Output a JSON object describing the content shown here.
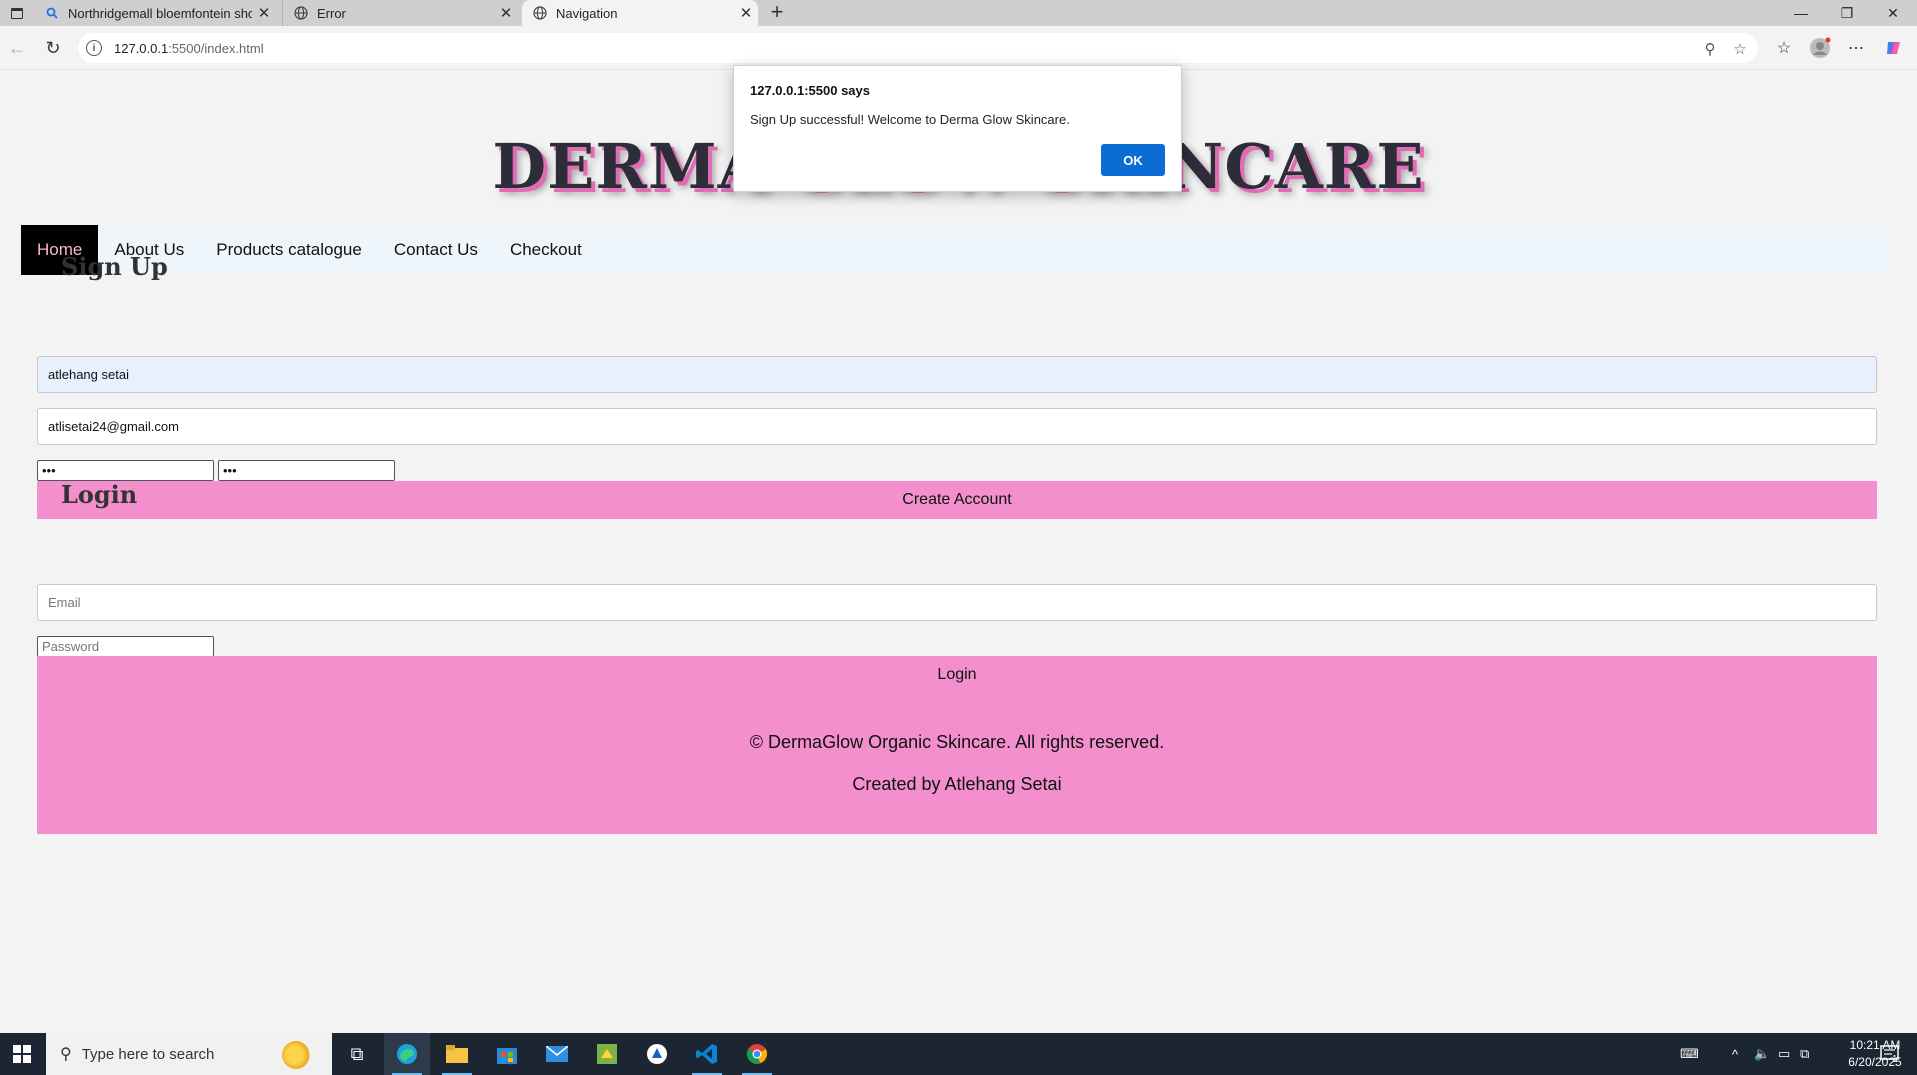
{
  "browser": {
    "tabs": [
      {
        "title": "Northridgemall bloemfontein sho",
        "icon": "search-icon"
      },
      {
        "title": "Error",
        "icon": "globe-icon"
      },
      {
        "title": "Navigation",
        "icon": "globe-icon"
      }
    ],
    "url_host": "127.0.0.1",
    "url_path": ":5500/index.html"
  },
  "site": {
    "brand": "DERMA GLOW SKINCARE",
    "nav": [
      "Home",
      "About Us",
      "Products catalogue",
      "Contact Us",
      "Checkout"
    ],
    "signup": {
      "title": "Sign Up",
      "name_value": "atlehang setai",
      "email_value": "atlisetai24@gmail.com",
      "password_mask": "•••",
      "confirm_mask": "•••",
      "button": "Create Account"
    },
    "login": {
      "title": "Login",
      "email_placeholder": "Email",
      "password_placeholder": "Password",
      "button": "Login"
    },
    "footer": {
      "line1": "© DermaGlow Organic Skincare. All rights reserved.",
      "line2": "Created by Atlehang Setai"
    }
  },
  "alert": {
    "header": "127.0.0.1:5500 says",
    "message": "Sign Up successful! Welcome to Derma Glow Skincare.",
    "ok": "OK"
  },
  "taskbar": {
    "search_placeholder": "Type here to search",
    "time": "10:21 AM",
    "date": "6/20/2025",
    "notification_count": "1"
  },
  "colors": {
    "pink": "#f38fcd",
    "nav_active_bg": "#000000",
    "nav_active_text": "#f7b6d2",
    "dialog_ok": "#0b6cd3"
  }
}
